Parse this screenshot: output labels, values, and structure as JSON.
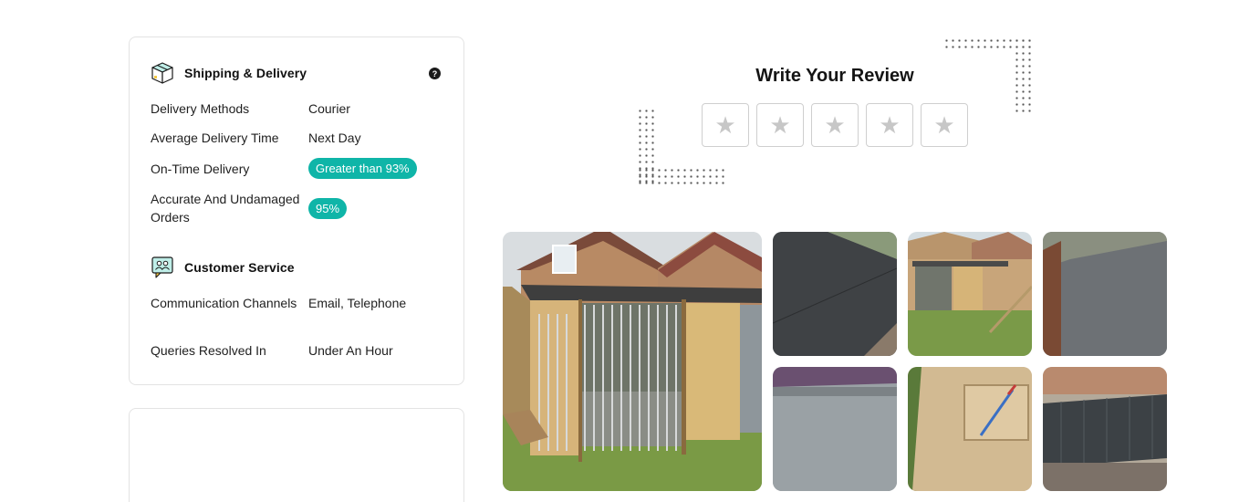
{
  "shipping": {
    "title": "Shipping & Delivery",
    "help_icon": "?",
    "rows": [
      {
        "label": "Delivery Methods",
        "value": "Courier"
      },
      {
        "label": "Average Delivery Time",
        "value": "Next Day"
      },
      {
        "label": "On-Time Delivery",
        "value": "Greater than 93%"
      },
      {
        "label": "Accurate And Undamaged Orders",
        "value": "95%"
      }
    ]
  },
  "customer_service": {
    "title": "Customer Service",
    "rows": [
      {
        "label": "Communication Channels",
        "value": "Email, Telephone"
      },
      {
        "label": "Queries Resolved In",
        "value": "Under An Hour"
      }
    ]
  },
  "review": {
    "title": "Write Your Review",
    "star_glyph": "★",
    "star_count": 5
  },
  "colors": {
    "accent_teal": "#0fb5a8",
    "star_gray": "#c7c7c7",
    "border": "#e3e3e3"
  },
  "icons": {
    "shipping": "box-icon",
    "customer_service": "chat-people-icon",
    "help": "question-circle-icon",
    "star": "star-icon"
  }
}
